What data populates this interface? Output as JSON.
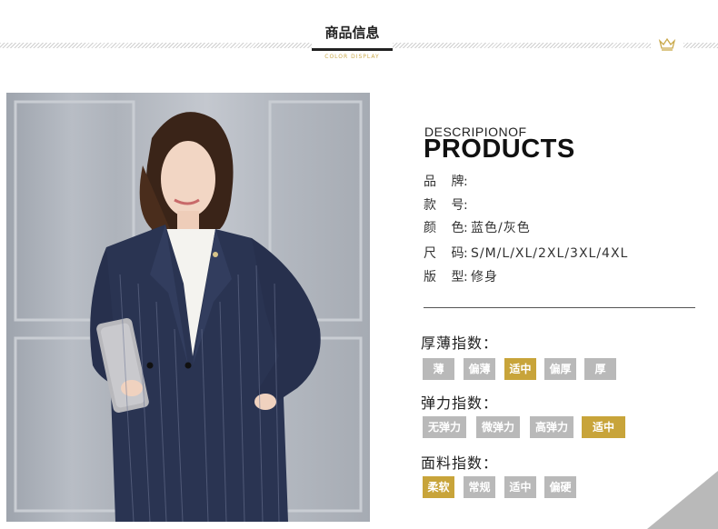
{
  "header": {
    "title": "商品信息",
    "subtitle": "COLOR DISPLAY"
  },
  "product": {
    "desc_small": "DESCRIPIONOF",
    "desc_big": "PRODUCTS",
    "specs": [
      {
        "key": "品 牌",
        "value": ""
      },
      {
        "key": "款 号",
        "value": ""
      },
      {
        "key": "颜 色",
        "value": "蓝色/灰色"
      },
      {
        "key": "尺 码",
        "value": "S/M/L/XL/2XL/3XL/4XL"
      },
      {
        "key": "版 型",
        "value": "修身"
      }
    ]
  },
  "indices": [
    {
      "title": "厚薄指数：",
      "tags": [
        "薄",
        "偏薄",
        "适中",
        "偏厚",
        "厚"
      ],
      "selected": "适中"
    },
    {
      "title": "弹力指数：",
      "tags": [
        "无弹力",
        "微弹力",
        "高弹力",
        "适中"
      ],
      "selected": "适中"
    },
    {
      "title": "面料指数：",
      "tags": [
        "柔软",
        "常规",
        "适中",
        "偏硬"
      ],
      "selected": "柔软"
    }
  ],
  "colors": {
    "accent_gold": "#c8a43a",
    "tag_gray": "#b9b9b9",
    "suit_navy": "#2a3452"
  },
  "icons": {
    "crown": "crown-icon",
    "corner": "corner-triangle"
  }
}
